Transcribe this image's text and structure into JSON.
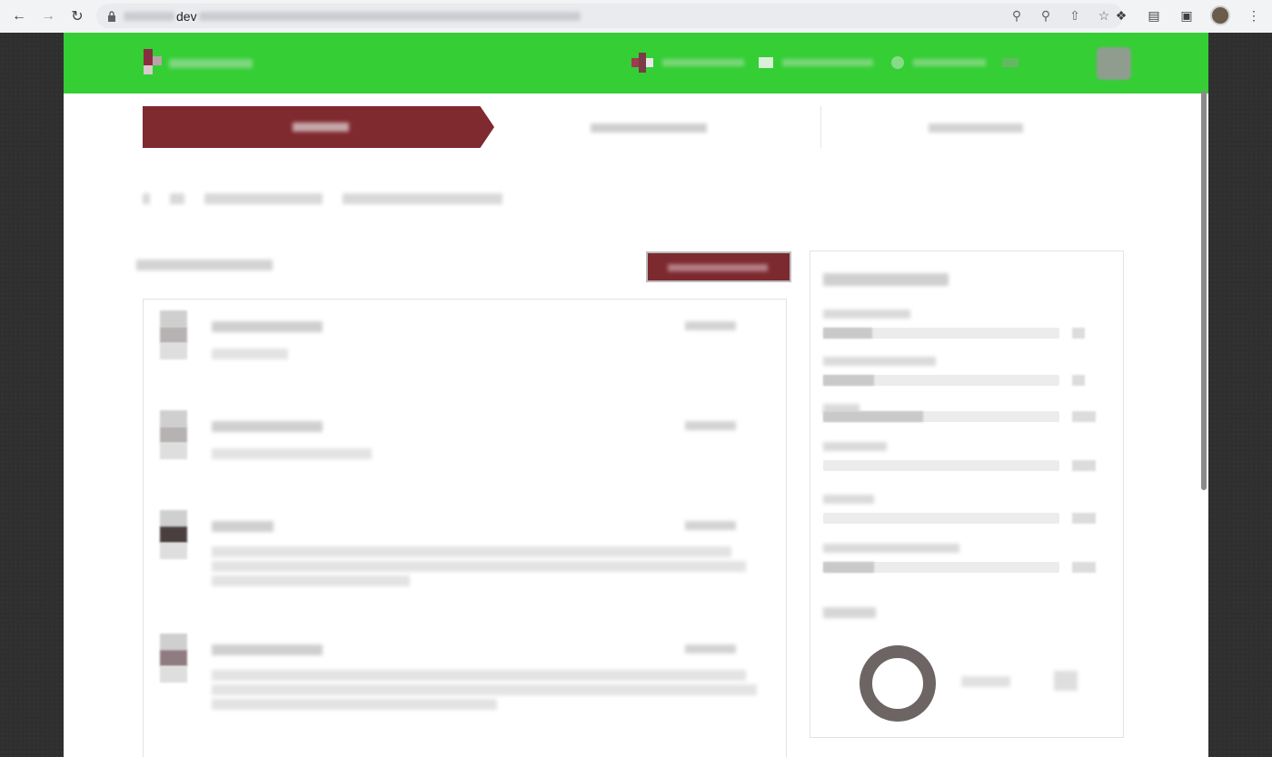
{
  "browser": {
    "url_visible_fragment": "dev",
    "icons": [
      "back-icon",
      "forward-icon",
      "reload-icon",
      "lock-icon",
      "key-icon",
      "zoom-icon",
      "share-icon",
      "star-icon",
      "extensions-icon",
      "cast-icon",
      "sidepanel-icon",
      "profile-avatar",
      "menu-icon"
    ]
  },
  "colors": {
    "topbar": "#35ce35",
    "accent": "#7f2a2f",
    "donut": "#6d6464"
  },
  "stepper": {
    "active_step": 1,
    "step_count": 3
  },
  "sidebar_stats": {
    "row_count": 7
  },
  "feed": {
    "entry_count": 4
  }
}
